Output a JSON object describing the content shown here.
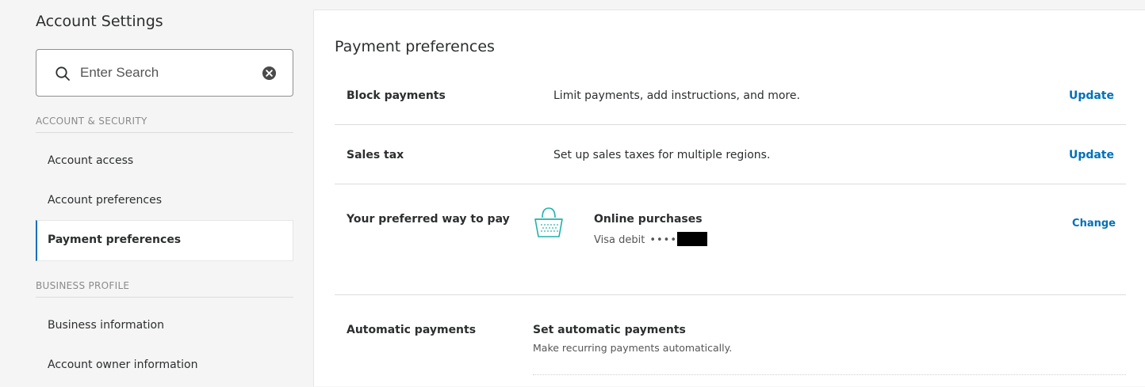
{
  "sidebar": {
    "title": "Account Settings",
    "search": {
      "placeholder": "Enter Search",
      "value": ""
    },
    "sections": [
      {
        "label": "ACCOUNT & SECURITY",
        "items": [
          {
            "label": "Account access"
          },
          {
            "label": "Account preferences"
          },
          {
            "label": "Payment preferences"
          }
        ]
      },
      {
        "label": "BUSINESS PROFILE",
        "items": [
          {
            "label": "Business information"
          },
          {
            "label": "Account owner information"
          }
        ]
      }
    ],
    "active_item": "Payment preferences"
  },
  "main": {
    "title": "Payment preferences",
    "rows": [
      {
        "label": "Block payments",
        "description": "Limit payments, add instructions, and more.",
        "action": "Update"
      },
      {
        "label": "Sales tax",
        "description": "Set up sales taxes for multiple regions.",
        "action": "Update"
      },
      {
        "label": "Your preferred way to pay",
        "icon": "shopping-basket-icon",
        "method_title": "Online purchases",
        "method_card": "Visa debit",
        "method_mask": "••••",
        "action": "Change"
      },
      {
        "label": "Automatic payments",
        "sub_title": "Set automatic payments",
        "sub_description": "Make recurring payments automatically."
      }
    ]
  },
  "colors": {
    "accent": "#0070ba",
    "basket_icon": "#1fb2aa",
    "sidebar_bg": "#f5f5f5",
    "panel_bg": "#ffffff"
  }
}
